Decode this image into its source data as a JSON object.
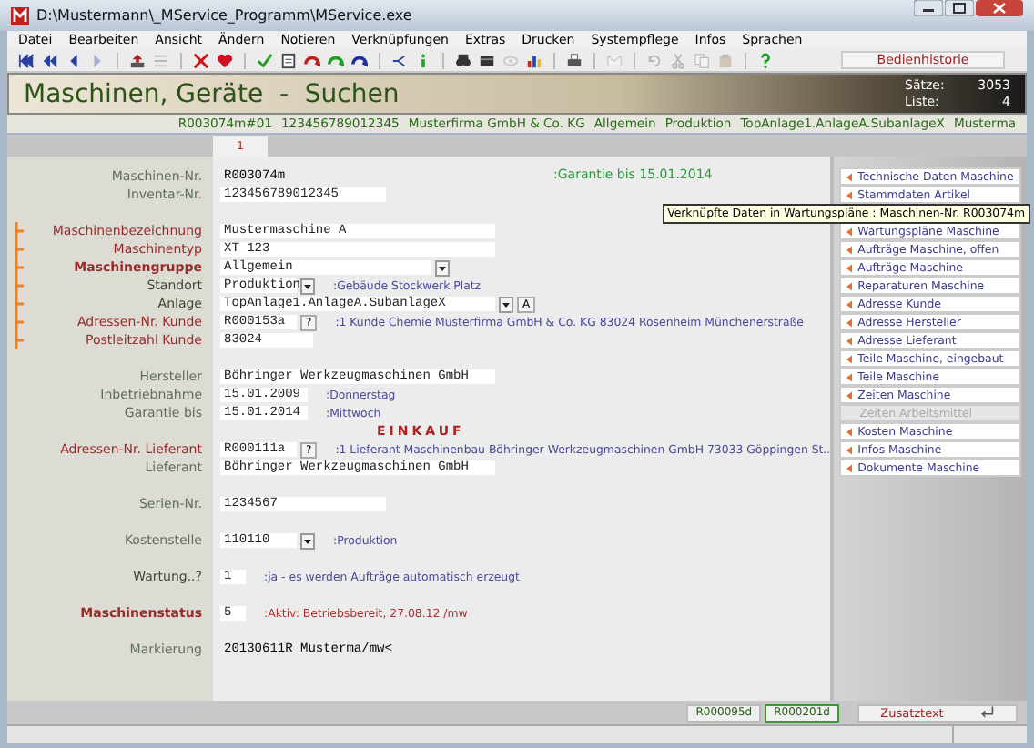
{
  "window": {
    "title": "D:\\Mustermann\\_MService_Programm\\MService.exe"
  },
  "menu": [
    "Datei",
    "Bearbeiten",
    "Ansicht",
    "Ändern",
    "Notieren",
    "Verknüpfungen",
    "Extras",
    "Drucken",
    "Systempflege",
    "Infos",
    "Sprachen"
  ],
  "toolbar": [
    {
      "kind": "first",
      "disabled": false
    },
    {
      "kind": "rewind",
      "disabled": false
    },
    {
      "kind": "prev",
      "disabled": false
    },
    {
      "kind": "next",
      "disabled": true
    },
    {
      "kind": "sep"
    },
    {
      "kind": "upload",
      "disabled": false
    },
    {
      "kind": "list",
      "disabled": true
    },
    {
      "kind": "sep"
    },
    {
      "kind": "delete",
      "disabled": false
    },
    {
      "kind": "heart",
      "disabled": false
    },
    {
      "kind": "sep"
    },
    {
      "kind": "check",
      "disabled": false
    },
    {
      "kind": "doc",
      "disabled": false
    },
    {
      "kind": "swirl-red",
      "disabled": false
    },
    {
      "kind": "swirl-green",
      "disabled": false
    },
    {
      "kind": "swirl-blue",
      "disabled": false
    },
    {
      "kind": "sep"
    },
    {
      "kind": "branch",
      "disabled": false
    },
    {
      "kind": "info",
      "disabled": false
    },
    {
      "kind": "sep"
    },
    {
      "kind": "binoculars",
      "disabled": false
    },
    {
      "kind": "bar",
      "disabled": false
    },
    {
      "kind": "eye",
      "disabled": true
    },
    {
      "kind": "chart",
      "disabled": false
    },
    {
      "kind": "sep"
    },
    {
      "kind": "printer",
      "disabled": false
    },
    {
      "kind": "sep"
    },
    {
      "kind": "mail",
      "disabled": true
    },
    {
      "kind": "sep"
    },
    {
      "kind": "undo",
      "disabled": true
    },
    {
      "kind": "cut",
      "disabled": true
    },
    {
      "kind": "copy",
      "disabled": true
    },
    {
      "kind": "paste",
      "disabled": true
    },
    {
      "kind": "sep"
    },
    {
      "kind": "help",
      "disabled": false
    }
  ],
  "history_button": "Bedienhistorie",
  "header": {
    "title": "Maschinen, Geräte  -  Suchen",
    "stats": [
      {
        "label": "Sätze:",
        "value": "3053"
      },
      {
        "label": "Liste:",
        "value": "4"
      }
    ]
  },
  "summary": [
    "R003074m#01",
    "123456789012345",
    "Musterfirma GmbH & Co. KG",
    "Allgemein",
    "Produktion",
    "TopAnlage1.AnlageA.SubanlageX",
    "Musterma"
  ],
  "tabs": [
    {
      "label": "1",
      "selected": true
    }
  ],
  "warranty_note": ":Garantie bis 15.01.2014",
  "sections": [
    {
      "rows": [
        {
          "label": "Maschinen-Nr.",
          "required": false,
          "bold": false,
          "emphasized": false,
          "marked": false,
          "field": {
            "kind": "plain",
            "value": "R003074m"
          }
        },
        {
          "label": "Inventar-Nr.",
          "required": false,
          "bold": false,
          "emphasized": false,
          "marked": false,
          "field": {
            "kind": "medium",
            "value": "123456789012345",
            "dropdown": false
          }
        }
      ]
    },
    {
      "rows": [
        {
          "label": "Maschinenbezeichnung",
          "required": true,
          "bold": false,
          "emphasized": false,
          "marked": true,
          "field": {
            "kind": "wide",
            "value": "Mustermaschine A",
            "dropdown": false
          }
        },
        {
          "label": "Maschinentyp",
          "required": true,
          "bold": false,
          "emphasized": false,
          "marked": true,
          "field": {
            "kind": "wide",
            "value": "XT 123",
            "dropdown": false
          }
        },
        {
          "label": "Maschinengruppe",
          "required": true,
          "bold": true,
          "emphasized": false,
          "marked": true,
          "field": {
            "kind": "select",
            "value": "Allgemein",
            "dropdown": true
          }
        },
        {
          "label": "Standort",
          "required": false,
          "bold": false,
          "emphasized": true,
          "marked": true,
          "field": {
            "kind": "code",
            "value": "Produktion",
            "dropdown": true
          },
          "info": {
            "text": ":Gebäude Stockwerk Platz",
            "alert": false
          }
        },
        {
          "label": "Anlage",
          "required": false,
          "bold": false,
          "emphasized": true,
          "marked": true,
          "field": {
            "kind": "wide",
            "value": "TopAnlage1.AnlageA.SubanlageX",
            "dropdown": true,
            "buttons": [
              "A"
            ]
          }
        },
        {
          "label": "Adressen-Nr. Kunde",
          "required": true,
          "bold": false,
          "emphasized": false,
          "marked": true,
          "field": {
            "kind": "code",
            "value": "R000153a",
            "dropdown": false,
            "buttons": [
              "?"
            ]
          },
          "info": {
            "text": ":1  Kunde  Chemie  Musterfirma GmbH & Co. KG  83024  Rosenheim  Münchenerstraße",
            "alert": false
          }
        },
        {
          "label": "Postleitzahl Kunde",
          "required": true,
          "bold": false,
          "emphasized": false,
          "marked": true,
          "field": {
            "kind": "short",
            "value": "83024",
            "dropdown": false
          }
        }
      ]
    },
    {
      "rows": [
        {
          "label": "Hersteller",
          "required": false,
          "bold": false,
          "emphasized": false,
          "marked": false,
          "field": {
            "kind": "wide",
            "value": "Böhringer Werkzeugmaschinen GmbH",
            "dropdown": false
          }
        },
        {
          "label": "Inbetriebnahme",
          "required": false,
          "bold": false,
          "emphasized": false,
          "marked": false,
          "field": {
            "kind": "date",
            "value": "15.01.2009",
            "dropdown": false
          },
          "info": {
            "text": ":Donnerstag",
            "alert": false
          }
        },
        {
          "label": "Garantie bis",
          "required": false,
          "bold": false,
          "emphasized": false,
          "marked": false,
          "field": {
            "kind": "date",
            "value": "15.01.2014",
            "dropdown": false
          },
          "info": {
            "text": ":Mittwoch",
            "alert": false
          }
        },
        {
          "kind": "heading",
          "text": "EINKAUF"
        },
        {
          "label": "Adressen-Nr. Lieferant",
          "required": true,
          "bold": false,
          "emphasized": false,
          "marked": false,
          "field": {
            "kind": "code",
            "value": "R000111a",
            "dropdown": false,
            "buttons": [
              "?"
            ]
          },
          "info": {
            "text": ":1  Lieferant  Maschinenbau  Böhringer Werkzeugmaschinen GmbH  73033  Göppingen  St..",
            "alert": false
          }
        },
        {
          "label": "Lieferant",
          "required": false,
          "bold": false,
          "emphasized": false,
          "marked": false,
          "field": {
            "kind": "wide",
            "value": "Böhringer Werkzeugmaschinen GmbH",
            "dropdown": false
          }
        }
      ]
    },
    {
      "rows": [
        {
          "label": "Serien-Nr.",
          "required": false,
          "bold": false,
          "emphasized": false,
          "marked": false,
          "field": {
            "kind": "medium",
            "value": "1234567",
            "dropdown": false
          }
        }
      ]
    },
    {
      "rows": [
        {
          "label": "Kostenstelle",
          "required": false,
          "bold": false,
          "emphasized": false,
          "marked": false,
          "field": {
            "kind": "code",
            "value": "110110",
            "dropdown": true
          },
          "info": {
            "text": ":Produktion",
            "alert": false
          }
        }
      ]
    },
    {
      "rows": [
        {
          "label": "Wartung..?",
          "required": false,
          "bold": false,
          "emphasized": true,
          "marked": false,
          "field": {
            "kind": "tiny",
            "value": "1",
            "dropdown": false
          },
          "info": {
            "text": ":ja - es werden Aufträge automatisch erzeugt",
            "alert": false
          }
        }
      ]
    },
    {
      "rows": [
        {
          "label": "Maschinenstatus",
          "required": true,
          "bold": true,
          "emphasized": false,
          "marked": false,
          "field": {
            "kind": "tiny",
            "value": "5",
            "dropdown": false
          },
          "info": {
            "text": ":Aktiv:  Betriebsbereit, 27.08.12 /mw",
            "alert": true
          }
        }
      ]
    },
    {
      "rows": [
        {
          "label": "Markierung",
          "required": false,
          "bold": false,
          "emphasized": false,
          "marked": false,
          "field": {
            "kind": "plain",
            "value": "20130611R Musterma/mw<"
          }
        }
      ]
    }
  ],
  "links": [
    {
      "kind": "link",
      "label": "Technische Daten Maschine",
      "disabled": false
    },
    {
      "kind": "link",
      "label": "Stammdaten Artikel",
      "disabled": false
    },
    {
      "kind": "tooltip",
      "label": "Verknüpfte Daten in Wartungspläne : Maschinen-Nr.  R003074m"
    },
    {
      "kind": "link",
      "label": "Wartungspläne Maschine",
      "disabled": false
    },
    {
      "kind": "link",
      "label": "Aufträge Maschine, offen",
      "disabled": false
    },
    {
      "kind": "link",
      "label": "Aufträge Maschine",
      "disabled": false
    },
    {
      "kind": "link",
      "label": "Reparaturen Maschine",
      "disabled": false
    },
    {
      "kind": "link",
      "label": "Adresse Kunde",
      "disabled": false
    },
    {
      "kind": "link",
      "label": "Adresse Hersteller",
      "disabled": false
    },
    {
      "kind": "link",
      "label": "Adresse Lieferant",
      "disabled": false
    },
    {
      "kind": "link",
      "label": "Teile Maschine, eingebaut",
      "disabled": false
    },
    {
      "kind": "link",
      "label": "Teile Maschine",
      "disabled": false
    },
    {
      "kind": "link",
      "label": "Zeiten Maschine",
      "disabled": false
    },
    {
      "kind": "link",
      "label": "Zeiten Arbeitsmittel",
      "disabled": true
    },
    {
      "kind": "link",
      "label": "Kosten Maschine",
      "disabled": false
    },
    {
      "kind": "link",
      "label": "Infos Maschine",
      "disabled": false
    },
    {
      "kind": "link",
      "label": "Dokumente Maschine",
      "disabled": false
    }
  ],
  "record_buttons": [
    {
      "label": "R000095d",
      "selected": false
    },
    {
      "label": "R000201d",
      "selected": true
    }
  ],
  "extra_button": "Zusatztext"
}
